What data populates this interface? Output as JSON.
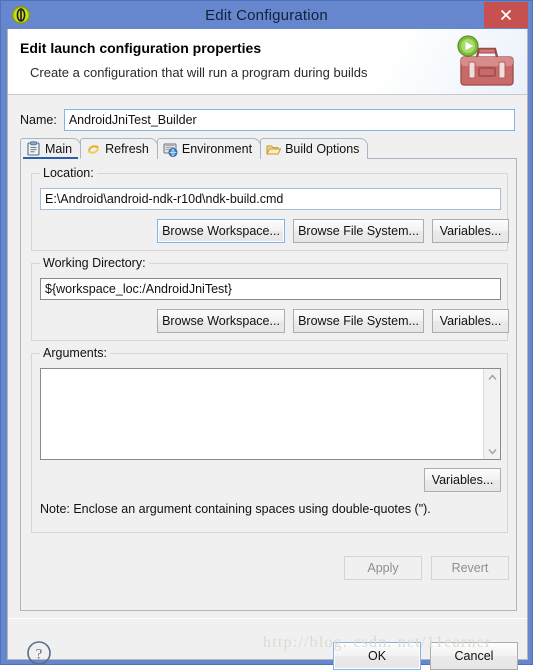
{
  "window": {
    "title": "Edit Configuration",
    "icon": "eclipse-launch-icon",
    "close_label": "×"
  },
  "banner": {
    "title": "Edit launch configuration properties",
    "subtitle": "Create a configuration that will run a program during builds",
    "icon": "toolbox-run-icon"
  },
  "name_field": {
    "label": "Name:",
    "value": "AndroidJniTest_Builder",
    "placeholder": ""
  },
  "tabs": [
    {
      "label": "Main",
      "icon": "clipboard-icon",
      "active": true
    },
    {
      "label": "Refresh",
      "icon": "refresh-arrows-icon",
      "active": false
    },
    {
      "label": "Environment",
      "icon": "environment-icon",
      "active": false
    },
    {
      "label": "Build Options",
      "icon": "folder-open-icon",
      "active": false
    }
  ],
  "location": {
    "group_title": "Location:",
    "value": "E:\\Android\\android-ndk-r10d\\ndk-build.cmd",
    "buttons": [
      {
        "label": "Browse Workspace...",
        "focused": true
      },
      {
        "label": "Browse File System...",
        "focused": false
      },
      {
        "label": "Variables...",
        "focused": false
      }
    ]
  },
  "working_directory": {
    "group_title": "Working Directory:",
    "value": "${workspace_loc:/AndroidJniTest}",
    "buttons": [
      {
        "label": "Browse Workspace...",
        "focused": false
      },
      {
        "label": "Browse File System...",
        "focused": false
      },
      {
        "label": "Variables...",
        "focused": false
      }
    ]
  },
  "arguments": {
    "group_title": "Arguments:",
    "value": "",
    "variables_label": "Variables...",
    "note": "Note: Enclose an argument containing spaces using double-quotes (\")."
  },
  "panel_buttons": {
    "apply": {
      "label": "Apply",
      "disabled": true
    },
    "revert": {
      "label": "Revert",
      "disabled": true
    }
  },
  "footer": {
    "help": "help-icon",
    "ok": {
      "label": "OK",
      "default": true
    },
    "cancel": {
      "label": "Cancel",
      "default": false
    }
  },
  "watermark": "http://blog. csdn. net/11earner",
  "colors": {
    "titlebar": "#6687ce",
    "close": "#c75050",
    "dialog_bg": "#f0f0f0",
    "focus_border": "#7eb4ea",
    "tab_active_underline": "#2c5fa8"
  }
}
